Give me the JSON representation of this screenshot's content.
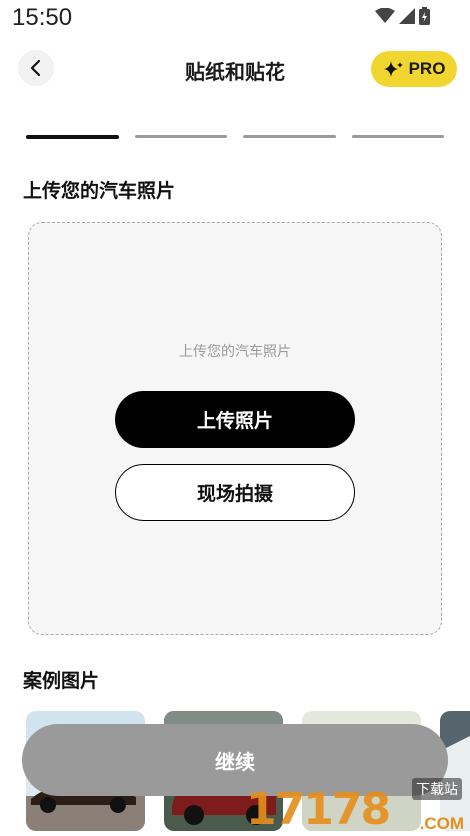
{
  "status_bar": {
    "time": "15:50"
  },
  "header": {
    "title": "贴纸和贴花",
    "pro_label": "PRO"
  },
  "steps": {
    "count": 4,
    "active_index": 0
  },
  "upload_section": {
    "title": "上传您的汽车照片",
    "hint": "上传您的汽车照片",
    "upload_button": "上传照片",
    "capture_button": "现场拍摄"
  },
  "examples_section": {
    "title": "案例图片"
  },
  "continue_button": "继续",
  "watermark": {
    "number": "17178",
    "sub": "下载站",
    "domain": ".COM"
  },
  "colors": {
    "accent": "#f2d630",
    "primary": "#000000",
    "disabled": "#9a9a9a"
  }
}
